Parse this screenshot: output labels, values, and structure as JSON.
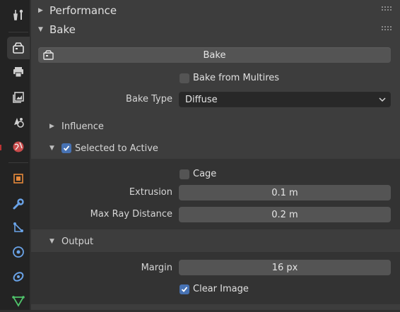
{
  "panels": {
    "performance": {
      "title": "Performance",
      "collapsed": true
    },
    "bake": {
      "title": "Bake",
      "bake_button": "Bake",
      "bake_from_multires": {
        "label": "Bake from Multires",
        "checked": false
      },
      "bake_type": {
        "label": "Bake Type",
        "value": "Diffuse"
      },
      "influence": {
        "title": "Influence",
        "collapsed": true
      },
      "selected_to_active": {
        "title": "Selected to Active",
        "checked": true,
        "cage": {
          "label": "Cage",
          "checked": false
        },
        "extrusion": {
          "label": "Extrusion",
          "value": "0.1 m"
        },
        "max_ray_distance": {
          "label": "Max Ray Distance",
          "value": "0.2 m"
        }
      },
      "output": {
        "title": "Output",
        "margin": {
          "label": "Margin",
          "value": "16 px"
        },
        "clear_image": {
          "label": "Clear Image",
          "checked": true
        }
      }
    }
  },
  "sidebar_tabs": [
    "tool",
    "render",
    "output",
    "view-layer",
    "scene",
    "world",
    "object",
    "modifiers",
    "particles",
    "physics",
    "constraints",
    "data"
  ],
  "active_tab": "render",
  "colors": {
    "accent": "#4772b3",
    "background": "#303030"
  }
}
